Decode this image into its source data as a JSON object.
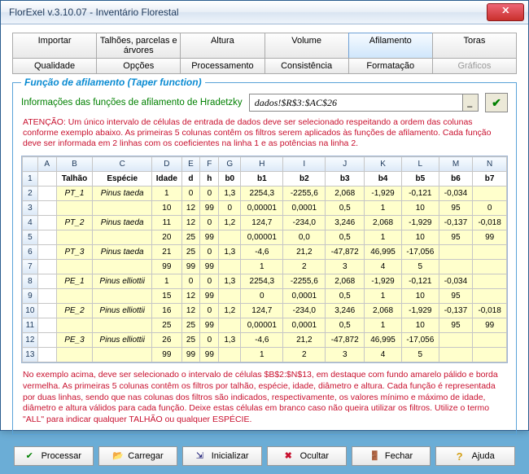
{
  "window": {
    "title": "FlorExel v.3.10.07 - Inventário Florestal"
  },
  "tabs_top": [
    {
      "label": "Importar"
    },
    {
      "label": "Talhões, parcelas e árvores"
    },
    {
      "label": "Altura"
    },
    {
      "label": "Volume"
    },
    {
      "label": "Afilamento",
      "active": true
    },
    {
      "label": "Toras"
    }
  ],
  "tabs_bottom": [
    {
      "label": "Qualidade"
    },
    {
      "label": "Opções"
    },
    {
      "label": "Processamento"
    },
    {
      "label": "Consistência"
    },
    {
      "label": "Formatação"
    },
    {
      "label": "Gráficos",
      "disabled": true
    }
  ],
  "group": {
    "title": "Função de afilamento (Taper function)",
    "info_label": "Informações das funções de afilamento de Hradetzky",
    "range_value": "dados!$R$3:$AC$26",
    "warn": "ATENÇÃO: Um único intervalo de células de entrada de dados deve ser selecionado respeitando a ordem das colunas conforme exemplo abaixo. As primeiras 5 colunas contêm os filtros serem aplicados às funções de afilamento. Cada função deve ser informada em 2 linhas com os coeficientes na linha 1 e as potências na linha 2.",
    "help": "No exemplo acima, deve ser selecionado o intervalo de células $B$2:$N$13, em destaque com fundo amarelo pálido e borda vermelha. As primeiras 5 colunas contêm os filtros por talhão, espécie, idade, diâmetro e altura. Cada função é representada por duas linhas, sendo que nas colunas dos filtros são indicados, respectivamente, os valores mínimo e máximo de idade, diâmetro e altura válidos para cada função. Deixe estas células em branco caso não queira utilizar os filtros. Utilize o termo \"ALL\" para indicar qualquer TALHÃO ou qualquer ESPÉCIE."
  },
  "sheet": {
    "col_letters": [
      "A",
      "B",
      "C",
      "D",
      "E",
      "F",
      "G",
      "H",
      "I",
      "J",
      "K",
      "L",
      "M",
      "N"
    ],
    "headers": [
      "Talhão",
      "Espécie",
      "Idade",
      "d",
      "h",
      "b0",
      "b1",
      "b2",
      "b3",
      "b4",
      "b5",
      "b6",
      "b7"
    ],
    "rows": [
      [
        "PT_1",
        "Pinus taeda",
        "1",
        "0",
        "0",
        "1,3",
        "2254,3",
        "-2255,6",
        "2,068",
        "-1,929",
        "-0,121",
        "-0,034",
        ""
      ],
      [
        "",
        "",
        "10",
        "12",
        "99",
        "0",
        "0,00001",
        "0,0001",
        "0,5",
        "1",
        "10",
        "95",
        "0"
      ],
      [
        "PT_2",
        "Pinus taeda",
        "11",
        "12",
        "0",
        "1,2",
        "124,7",
        "-234,0",
        "3,246",
        "2,068",
        "-1,929",
        "-0,137",
        "-0,018"
      ],
      [
        "",
        "",
        "20",
        "25",
        "99",
        "",
        "0,00001",
        "0,0",
        "0,5",
        "1",
        "10",
        "95",
        "99"
      ],
      [
        "PT_3",
        "Pinus taeda",
        "21",
        "25",
        "0",
        "1,3",
        "-4,6",
        "21,2",
        "-47,872",
        "46,995",
        "-17,056",
        "",
        ""
      ],
      [
        "",
        "",
        "99",
        "99",
        "99",
        "",
        "1",
        "2",
        "3",
        "4",
        "5",
        "",
        ""
      ],
      [
        "PE_1",
        "Pinus elliottii",
        "1",
        "0",
        "0",
        "1,3",
        "2254,3",
        "-2255,6",
        "2,068",
        "-1,929",
        "-0,121",
        "-0,034",
        ""
      ],
      [
        "",
        "",
        "15",
        "12",
        "99",
        "",
        "0",
        "0,0001",
        "0,5",
        "1",
        "10",
        "95",
        ""
      ],
      [
        "PE_2",
        "Pinus elliottii",
        "16",
        "12",
        "0",
        "1,2",
        "124,7",
        "-234,0",
        "3,246",
        "2,068",
        "-1,929",
        "-0,137",
        "-0,018"
      ],
      [
        "",
        "",
        "25",
        "25",
        "99",
        "",
        "0,00001",
        "0,0001",
        "0,5",
        "1",
        "10",
        "95",
        "99"
      ],
      [
        "PE_3",
        "Pinus elliottii",
        "26",
        "25",
        "0",
        "1,3",
        "-4,6",
        "21,2",
        "-47,872",
        "46,995",
        "-17,056",
        "",
        ""
      ],
      [
        "",
        "",
        "99",
        "99",
        "99",
        "",
        "1",
        "2",
        "3",
        "4",
        "5",
        "",
        ""
      ]
    ]
  },
  "buttons": {
    "process": "Processar",
    "load": "Carregar",
    "init": "Inicializar",
    "hide": "Ocultar",
    "close": "Fechar",
    "help": "Ajuda"
  }
}
